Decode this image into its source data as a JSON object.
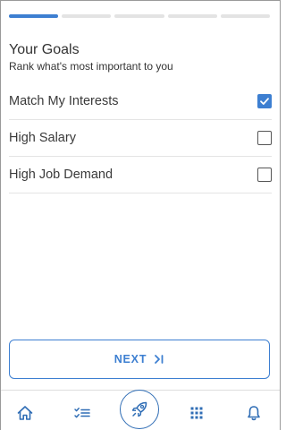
{
  "progress": {
    "total_steps": 5,
    "current_step": 1
  },
  "header": {
    "title": "Your Goals",
    "subtitle": "Rank what's most important to you"
  },
  "options": [
    {
      "label": "Match My Interests",
      "checked": true
    },
    {
      "label": "High Salary",
      "checked": false
    },
    {
      "label": "High Job Demand",
      "checked": false
    }
  ],
  "next_button": {
    "label": "NEXT"
  },
  "bottom_nav": {
    "items": [
      {
        "icon": "home-icon"
      },
      {
        "icon": "checklist-icon"
      },
      {
        "icon": "rocket-icon"
      },
      {
        "icon": "apps-grid-icon"
      },
      {
        "icon": "bell-icon"
      }
    ]
  },
  "colors": {
    "accent": "#3d7fd1",
    "nav_icon": "#2f6db5"
  }
}
